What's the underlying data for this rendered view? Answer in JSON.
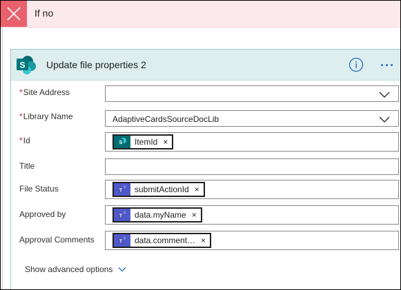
{
  "condition_branch": {
    "title": "If no"
  },
  "action": {
    "title": "Update file properties 2",
    "fields": {
      "site_address": {
        "label": "Site Address",
        "required": true,
        "value": ""
      },
      "library_name": {
        "label": "Library Name",
        "required": true,
        "value": "AdaptiveCardsSourceDocLib"
      },
      "id": {
        "label": "Id",
        "required": true,
        "token": {
          "label": "ItemId",
          "icon": "sharepoint-icon"
        }
      },
      "title": {
        "label": "Title",
        "required": false,
        "value": ""
      },
      "file_status": {
        "label": "File Status",
        "required": false,
        "token": {
          "label": "submitActionId",
          "icon": "teams-icon"
        }
      },
      "approved_by": {
        "label": "Approved by",
        "required": false,
        "token": {
          "label": "data.myName",
          "icon": "teams-icon"
        }
      },
      "approval_comments": {
        "label": "Approval Comments",
        "required": false,
        "token": {
          "label": "data.comment…",
          "icon": "teams-icon"
        }
      }
    },
    "advanced_options_label": "Show advanced options",
    "required_marker": "*",
    "token_remove": "×"
  },
  "colors": {
    "branch_header_bg": "#fce9eb",
    "branch_close_bg": "#e8616c",
    "card_header_bg": "#deeeee",
    "sharepoint": "#036c70",
    "teams": "#5059c9",
    "accent": "#1f6dc5",
    "required": "#a4262c"
  }
}
